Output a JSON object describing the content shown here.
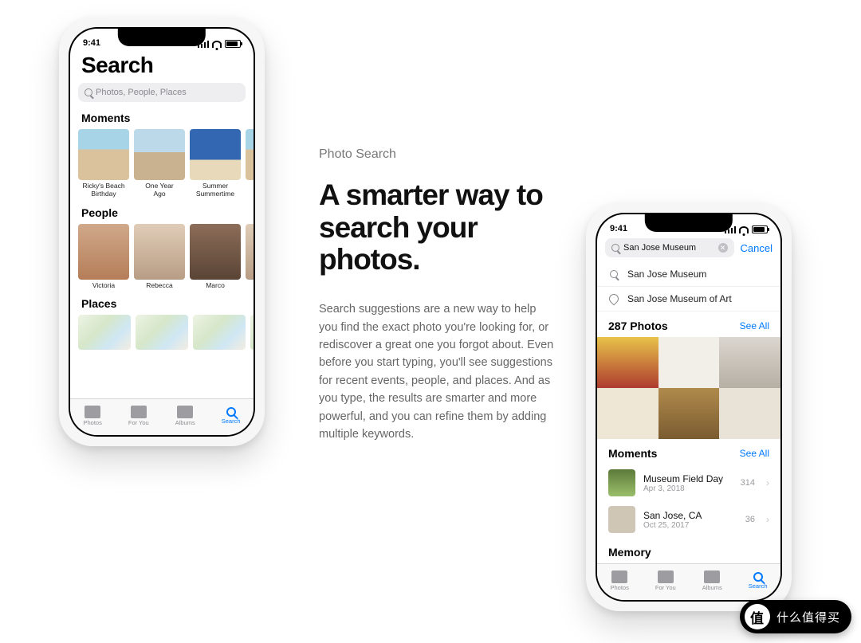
{
  "status": {
    "time": "9:41"
  },
  "copy": {
    "eyebrow": "Photo Search",
    "headline": "A smarter way to search your photos.",
    "body": "Search suggestions are a new way to help you find the exact photo you're looking for, or rediscover a great one you forgot about. Even before you start typing, you'll see suggestions for recent events, people, and places. And as you type, the results are smarter and more powerful, and you can refine them by adding multiple keywords."
  },
  "phone1": {
    "title": "Search",
    "search_placeholder": "Photos, People, Places",
    "sections": {
      "moments": "Moments",
      "people": "People",
      "places": "Places"
    },
    "moments": [
      {
        "line1": "Ricky's Beach",
        "line2": "Birthday"
      },
      {
        "line1": "One Year",
        "line2": "Ago"
      },
      {
        "line1": "Summer",
        "line2": "Summertime"
      }
    ],
    "people": [
      {
        "name": "Victoria"
      },
      {
        "name": "Rebecca"
      },
      {
        "name": "Marco"
      }
    ],
    "tabs": {
      "photos": "Photos",
      "foryou": "For You",
      "albums": "Albums",
      "search": "Search"
    }
  },
  "phone2": {
    "search_value": "San Jose Museum",
    "cancel": "Cancel",
    "suggestions": [
      {
        "icon": "search",
        "label": "San Jose Museum"
      },
      {
        "icon": "pin",
        "label": "San Jose Museum of Art"
      }
    ],
    "result_count_label": "287 Photos",
    "see_all": "See All",
    "moments_header": "Moments",
    "moments": [
      {
        "title": "Museum Field Day",
        "subtitle": "Apr 3, 2018",
        "count": "314"
      },
      {
        "title": "San Jose, CA",
        "subtitle": "Oct 25, 2017",
        "count": "36"
      }
    ],
    "memory_header": "Memory",
    "tabs": {
      "photos": "Photos",
      "foryou": "For You",
      "albums": "Albums",
      "search": "Search"
    }
  },
  "badge": {
    "symbol": "值",
    "text": "什么值得买"
  }
}
